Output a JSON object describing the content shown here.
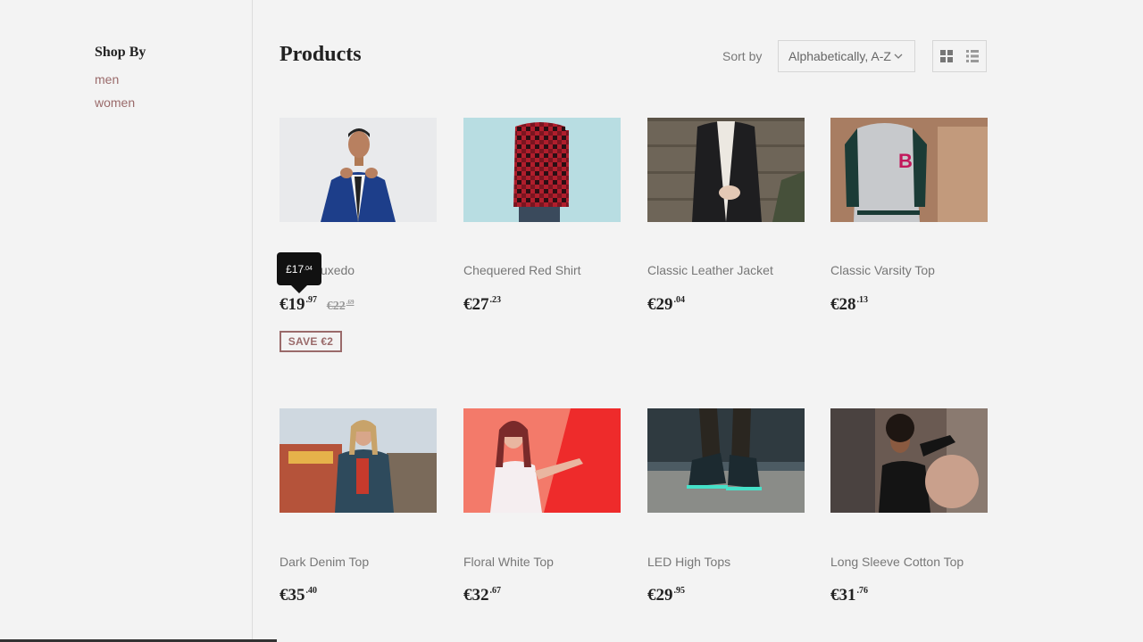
{
  "sidebar": {
    "title": "Shop By",
    "links": [
      "men",
      "women"
    ]
  },
  "header": {
    "title": "Products",
    "sort_label": "Sort by",
    "sort_value": "Alphabetically, A-Z"
  },
  "tooltip": {
    "main": "£17",
    "cents": ".04"
  },
  "products": [
    {
      "title": "Black Tuxedo",
      "price_main": "€19",
      "price_cents": ".97",
      "old_main": "€22",
      "old_cents": ".69",
      "badge": "SAVE €2"
    },
    {
      "title": "Chequered Red Shirt",
      "price_main": "€27",
      "price_cents": ".23"
    },
    {
      "title": "Classic Leather Jacket",
      "price_main": "€29",
      "price_cents": ".04"
    },
    {
      "title": "Classic Varsity Top",
      "price_main": "€28",
      "price_cents": ".13"
    },
    {
      "title": "Dark Denim Top",
      "price_main": "€35",
      "price_cents": ".40"
    },
    {
      "title": "Floral White Top",
      "price_main": "€32",
      "price_cents": ".67"
    },
    {
      "title": "LED High Tops",
      "price_main": "€29",
      "price_cents": ".95"
    },
    {
      "title": "Long Sleeve Cotton Top",
      "price_main": "€31",
      "price_cents": ".76"
    }
  ],
  "colors": {
    "accent": "#9a6a6a",
    "text": "#222222",
    "muted": "#777777",
    "background": "#f3f3f3"
  },
  "icons": [
    "chevron-down-icon",
    "grid-view-icon",
    "list-view-icon"
  ]
}
